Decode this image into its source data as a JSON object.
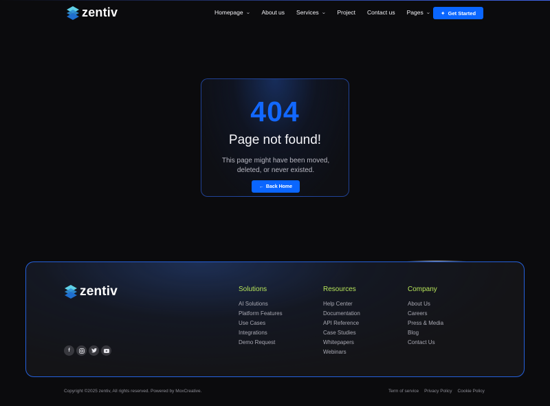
{
  "brand": {
    "name": "zentiv"
  },
  "nav": {
    "items": [
      {
        "label": "Homepage",
        "dropdown": true
      },
      {
        "label": "About us",
        "dropdown": false
      },
      {
        "label": "Services",
        "dropdown": true
      },
      {
        "label": "Project",
        "dropdown": false
      },
      {
        "label": "Contact us",
        "dropdown": false
      },
      {
        "label": "Pages",
        "dropdown": true
      }
    ],
    "cta_label": "Get Started"
  },
  "error": {
    "code": "404",
    "title": "Page not found!",
    "description": "This page might have been moved, deleted, or never existed.",
    "back_label": "Back Home"
  },
  "footer": {
    "socials": [
      "facebook-icon",
      "instagram-icon",
      "twitter-icon",
      "youtube-icon"
    ],
    "columns": [
      {
        "title": "Solutions",
        "links": [
          "AI Solutions",
          "Platform Features",
          "Use Cases",
          "Integrations",
          "Demo Request"
        ]
      },
      {
        "title": "Resources",
        "links": [
          "Help Center",
          "Documentation",
          "API Reference",
          "Case Studies",
          "Whitepapers",
          "Webinars"
        ]
      },
      {
        "title": "Company",
        "links": [
          "About Us",
          "Careers",
          "Press & Media",
          "Blog",
          "Contact Us"
        ]
      }
    ],
    "copyright": "Copyright ©2025 zentiv, All rights reserved. Powered by MoxCreative.",
    "legal": [
      "Term of service",
      "Privacy Policy",
      "Cookie Policy"
    ]
  },
  "colors": {
    "accent": "#0a66ff",
    "error_code": "#1268ff",
    "column_title": "#b6e45a",
    "background": "#0b0b0d"
  }
}
